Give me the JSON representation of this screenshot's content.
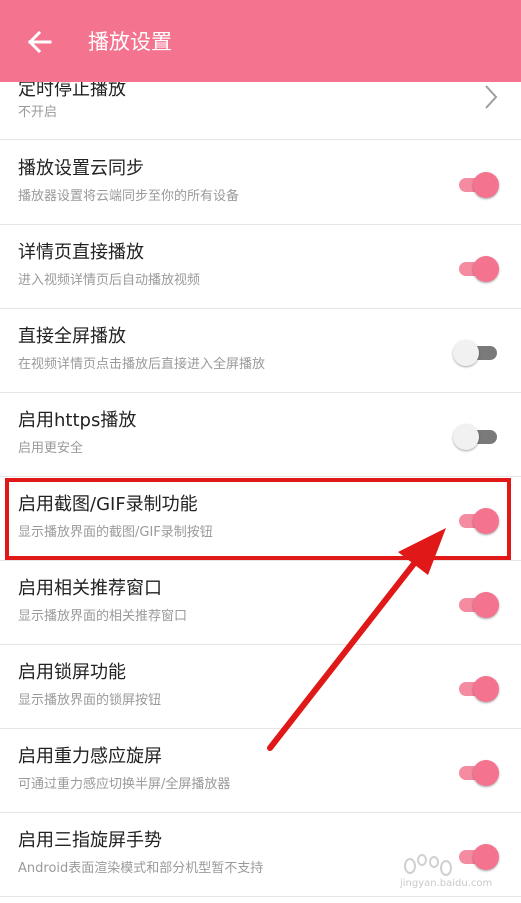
{
  "header": {
    "title": "播放设置"
  },
  "settings": [
    {
      "title": "定时停止播放",
      "subtitle": "不开启",
      "control": "chevron"
    },
    {
      "title": "播放设置云同步",
      "subtitle": "播放器设置将云端同步至你的所有设备",
      "control": "toggle",
      "on": true
    },
    {
      "title": "详情页直接播放",
      "subtitle": "进入视频详情页后自动播放视频",
      "control": "toggle",
      "on": true
    },
    {
      "title": "直接全屏播放",
      "subtitle": "在视频详情页点击播放后直接进入全屏播放",
      "control": "toggle",
      "on": false
    },
    {
      "title": "启用https播放",
      "subtitle": "启用更安全",
      "control": "toggle",
      "on": false
    },
    {
      "title": "启用截图/GIF录制功能",
      "subtitle": "显示播放界面的截图/GIF录制按钮",
      "control": "toggle",
      "on": true
    },
    {
      "title": "启用相关推荐窗口",
      "subtitle": "显示播放界面的相关推荐窗口",
      "control": "toggle",
      "on": true
    },
    {
      "title": "启用锁屏功能",
      "subtitle": "显示播放界面的锁屏按钮",
      "control": "toggle",
      "on": true
    },
    {
      "title": "启用重力感应旋屏",
      "subtitle": "可通过重力感应切换半屏/全屏播放器",
      "control": "toggle",
      "on": true
    },
    {
      "title": "启用三指旋屏手势",
      "subtitle": "Android表面渲染模式和部分机型暂不支持",
      "control": "toggle",
      "on": true
    }
  ],
  "watermark": {
    "text": "jingyan.baidu.com"
  },
  "colors": {
    "accent": "#f4738f",
    "annotation": "#e01818"
  },
  "icons": {
    "back": "arrow-left-icon",
    "chevron": "chevron-right-icon"
  }
}
